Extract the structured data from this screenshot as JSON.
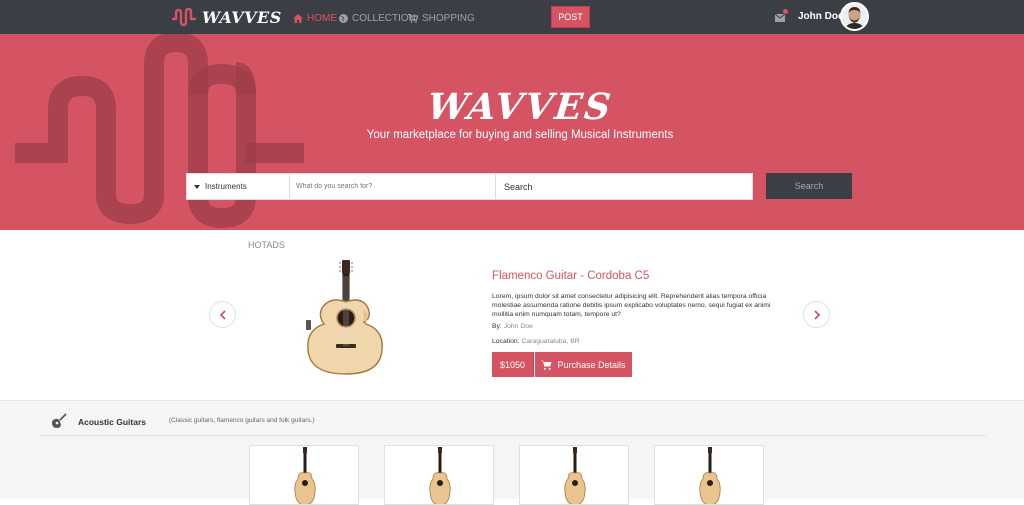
{
  "nav": {
    "brand": "WAVVES",
    "links": [
      {
        "label": "HOME",
        "icon": "home-icon",
        "active": true
      },
      {
        "label": "COLLECTION",
        "icon": "globe-icon",
        "active": false
      },
      {
        "label": "SHOPPING",
        "icon": "cart-icon",
        "active": false
      }
    ],
    "post_label": "POST",
    "user_name": "John Doe"
  },
  "hero": {
    "title": "WAVVES",
    "subtitle": "Your marketplace for buying and selling Musical Instruments"
  },
  "search": {
    "category": "Instruments",
    "query_placeholder": "What do you search for?",
    "location_value": "Search",
    "button_label": "Search"
  },
  "hotads": {
    "label": "HOTADS",
    "product": {
      "title": "Flamenco Guitar - Cordoba C5",
      "description": "Lorem, ipsum dolor sit amet consectetur adipisicing elit. Reprehenderit alias tempora officia molestiae assumenda ratione debitis ipsum explicabo voluptates nemo, sequi fugiat ex animi mollitia enim numquam totam, tempore ut?",
      "by_label": "By:",
      "by_value": "John Doe",
      "location_label": "Location:",
      "location_value": "Caraguatatuba, BR",
      "price": "$1050",
      "details_label": "Purchase Details"
    }
  },
  "category": {
    "title": "Acoustic Guitars",
    "description": "(Classic guitars, flamenco guitars and folk guitars.)"
  },
  "colors": {
    "accent": "#d45463",
    "navbar": "#3b3e45",
    "search_button": "#3b3e45"
  }
}
